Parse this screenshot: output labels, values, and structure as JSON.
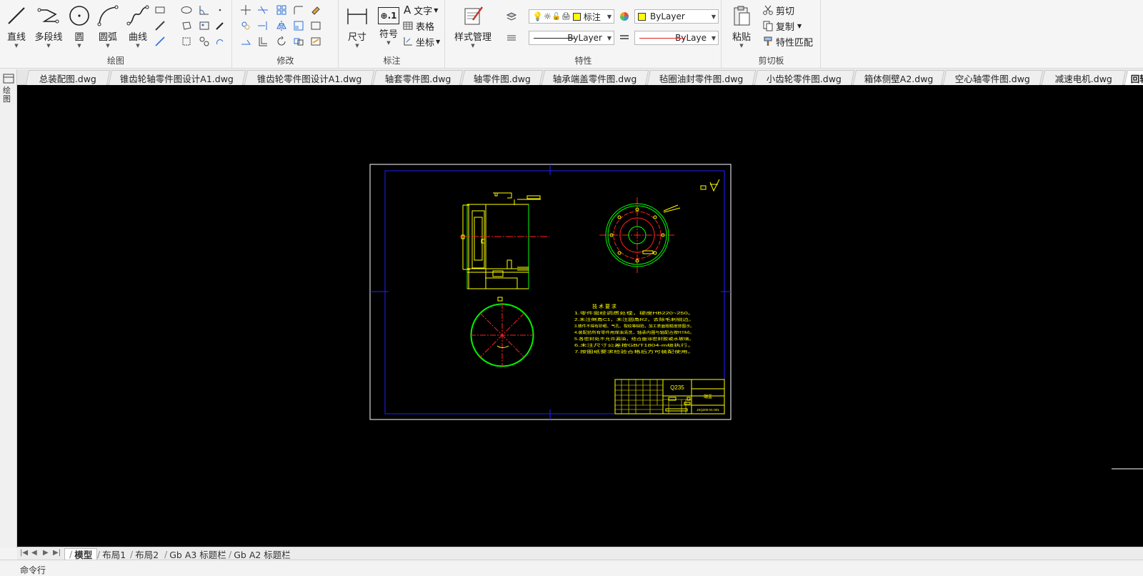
{
  "ribbon": {
    "draw": {
      "title": "绘图",
      "line": "直线",
      "polyline": "多段线",
      "circle": "圆",
      "arc": "圆弧",
      "curve": "曲线"
    },
    "modify": {
      "title": "修改"
    },
    "annotate": {
      "title": "标注",
      "dimension": "尺寸",
      "symbol": "符号",
      "symbol_glyph": "⊕.1",
      "text": "文字",
      "table": "表格",
      "coordinate": "坐标"
    },
    "properties": {
      "title": "特性",
      "style_manager": "样式管理",
      "layer_name": "标注",
      "color_value": "ByLayer",
      "linetype_value": "ByLayer",
      "lineweight_value": "ByLaye"
    },
    "clipboard": {
      "title": "剪切板",
      "paste": "粘贴",
      "cut": "剪切",
      "copy": "复制",
      "match_properties": "特性匹配"
    }
  },
  "doc_tabs": [
    "总装配图.dwg",
    "锥齿轮轴零件图设计A1.dwg",
    "锥齿轮零件图设计A1.dwg",
    "轴套零件图.dwg",
    "轴零件图.dwg",
    "轴承端盖零件图.dwg",
    "毡圈油封零件图.dwg",
    "小齿轮零件图.dwg",
    "箱体侧壁A2.dwg",
    "空心轴零件图.dwg",
    "减速电机.dwg",
    "回转"
  ],
  "left_strip_text": "绘图",
  "drawing": {
    "tech_title": "技 术 要 求",
    "tech_lines": [
      "1.零件需经调质处理，硬度HB220~250。",
      "2.未注倒角C1，未注圆角R2，去除毛刺锐边。",
      "3.铸件不得有砂眼、气孔、裂纹等缺陷，加工表面粗糙度按图示。",
      "4.装配前所有零件用煤油清洗，轴承内圈与轴配合按H7/k6。",
      "5.各密封处不允许漏油，结合面涂密封胶或水玻璃。",
      "6.未注尺寸公差按GB/T1804-m级执行。",
      "7.按图纸要求检验合格后方可装配使用。"
    ],
    "material": "Q235",
    "part_name": "端盖",
    "drawing_no": "JSQ200-01-001"
  },
  "layout_tabs": [
    "模型",
    "布局1",
    "布局2",
    "Gb A3 标题栏",
    "Gb A2 标题栏"
  ],
  "layout_nav": [
    "|◀",
    "◀",
    "▶",
    "▶|"
  ],
  "command_label": "命令行",
  "colors": {
    "canvas": "#000000",
    "sheet_border": "#ffffff",
    "inner_frame": "#1a1aff",
    "geometry_yellow": "#ffff00",
    "geometry_green": "#00ff00",
    "centerline_red": "#ff2020"
  }
}
